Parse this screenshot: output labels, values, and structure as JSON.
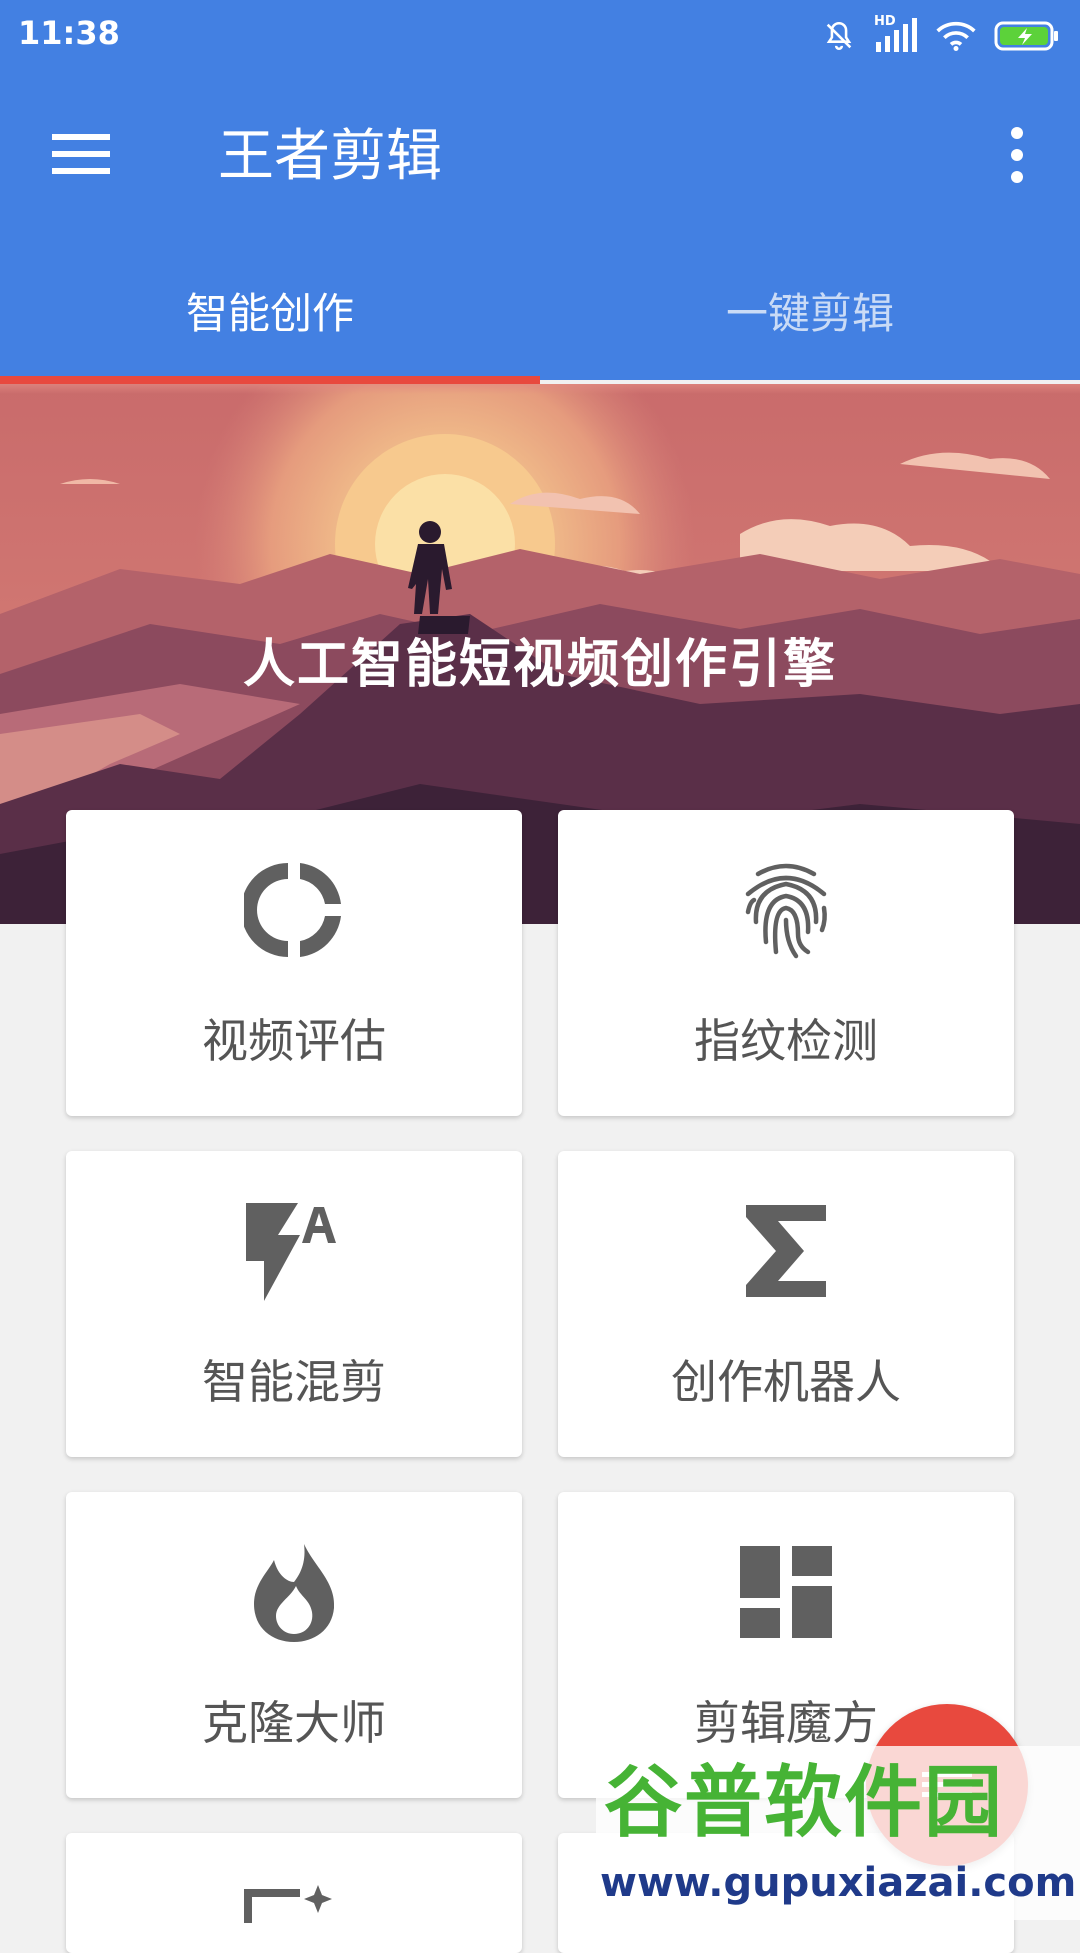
{
  "status_bar": {
    "time": "11:38",
    "network_label": "HD"
  },
  "app_bar": {
    "title": "王者剪辑",
    "menu_icon": "hamburger-menu-icon",
    "more_icon": "more-vertical-icon"
  },
  "tabs": [
    {
      "label": "智能创作",
      "selected": true
    },
    {
      "label": "一键剪辑",
      "selected": false
    }
  ],
  "hero": {
    "title": "人工智能短视频创作引擎"
  },
  "cards": [
    {
      "label": "视频评估",
      "icon": "donut-chart-icon"
    },
    {
      "label": "指纹检测",
      "icon": "fingerprint-icon"
    },
    {
      "label": "智能混剪",
      "icon": "flash-auto-icon"
    },
    {
      "label": "创作机器人",
      "icon": "sigma-icon"
    },
    {
      "label": "克隆大师",
      "icon": "flame-icon"
    },
    {
      "label": "剪辑魔方",
      "icon": "dashboard-grid-icon"
    }
  ],
  "watermark": {
    "title": "谷普软件园",
    "url": "www.gupuxiazai.com"
  },
  "colors": {
    "primary": "#4380e2",
    "accent": "#e8493e",
    "card_text": "#555555",
    "icon": "#606060"
  }
}
